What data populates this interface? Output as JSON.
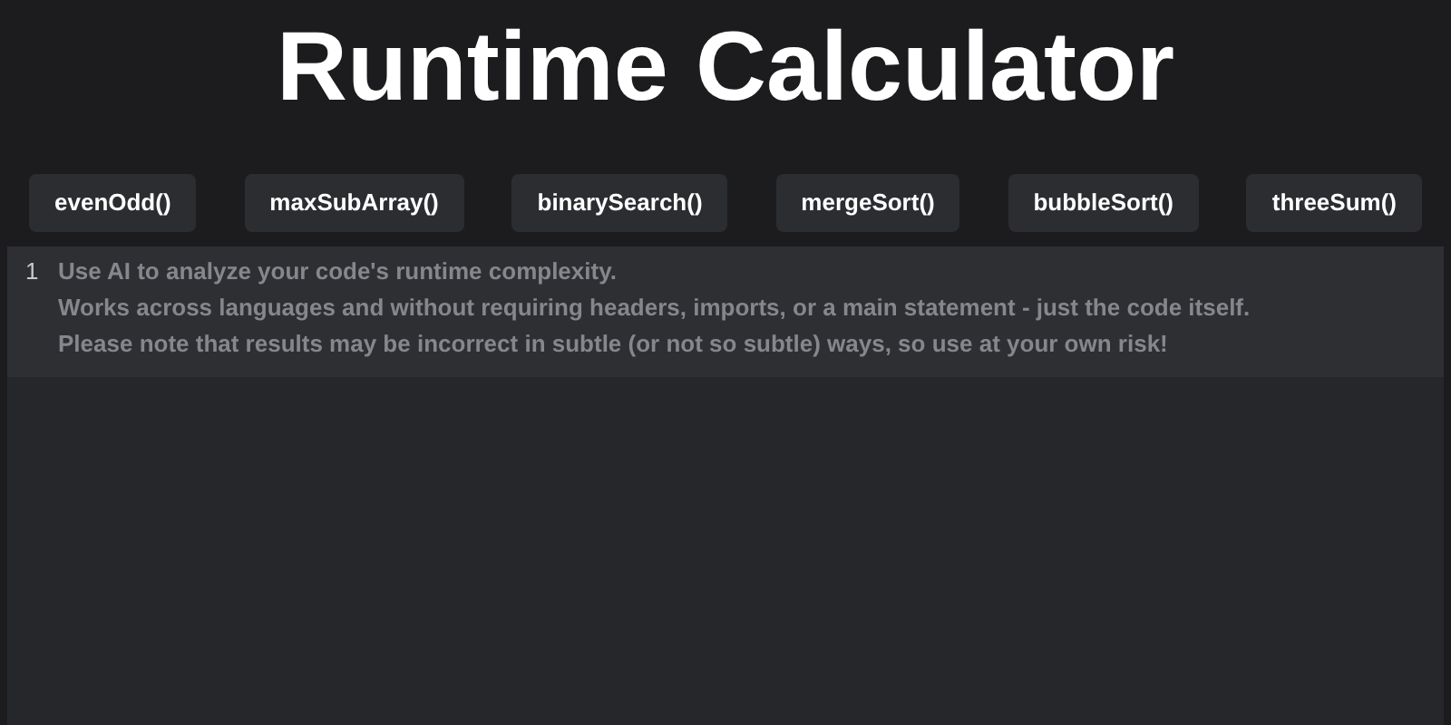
{
  "title": "Runtime Calculator",
  "examples": [
    {
      "label": "evenOdd()"
    },
    {
      "label": "maxSubArray()"
    },
    {
      "label": "binarySearch()"
    },
    {
      "label": "mergeSort()"
    },
    {
      "label": "bubbleSort()"
    },
    {
      "label": "threeSum()"
    }
  ],
  "editor": {
    "line_number": "1",
    "placeholder": [
      "Use AI to analyze your code's runtime complexity.",
      "Works across languages and without requiring headers, imports, or a main statement - just the code itself.",
      "Please note that results may be incorrect in subtle (or not so subtle) ways, so use at your own risk!"
    ]
  }
}
